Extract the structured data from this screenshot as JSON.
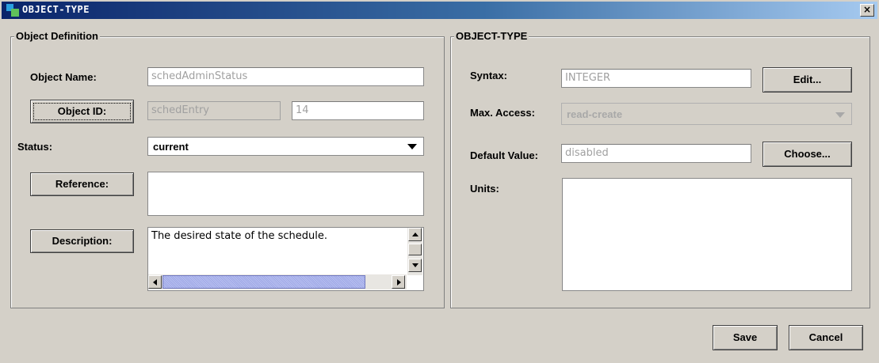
{
  "window": {
    "title": "OBJECT-TYPE",
    "close_label": "×"
  },
  "left_group": {
    "title": "Object Definition",
    "object_name_label": "Object Name:",
    "object_name_value": "schedAdminStatus",
    "object_id_button": "Object ID:",
    "object_id_parent": "schedEntry",
    "object_id_index": "14",
    "status_label": "Status:",
    "status_value": "current",
    "reference_button": "Reference:",
    "reference_value": "",
    "description_button": "Description:",
    "description_value": "The desired state of the schedule."
  },
  "right_group": {
    "title": "OBJECT-TYPE",
    "syntax_label": "Syntax:",
    "syntax_value": "INTEGER",
    "edit_button": "Edit...",
    "max_access_label": "Max. Access:",
    "max_access_value": "read-create",
    "default_value_label": "Default Value:",
    "default_value_value": "disabled",
    "choose_button": "Choose...",
    "units_label": "Units:",
    "units_value": ""
  },
  "footer": {
    "save_button": "Save",
    "cancel_button": "Cancel"
  }
}
